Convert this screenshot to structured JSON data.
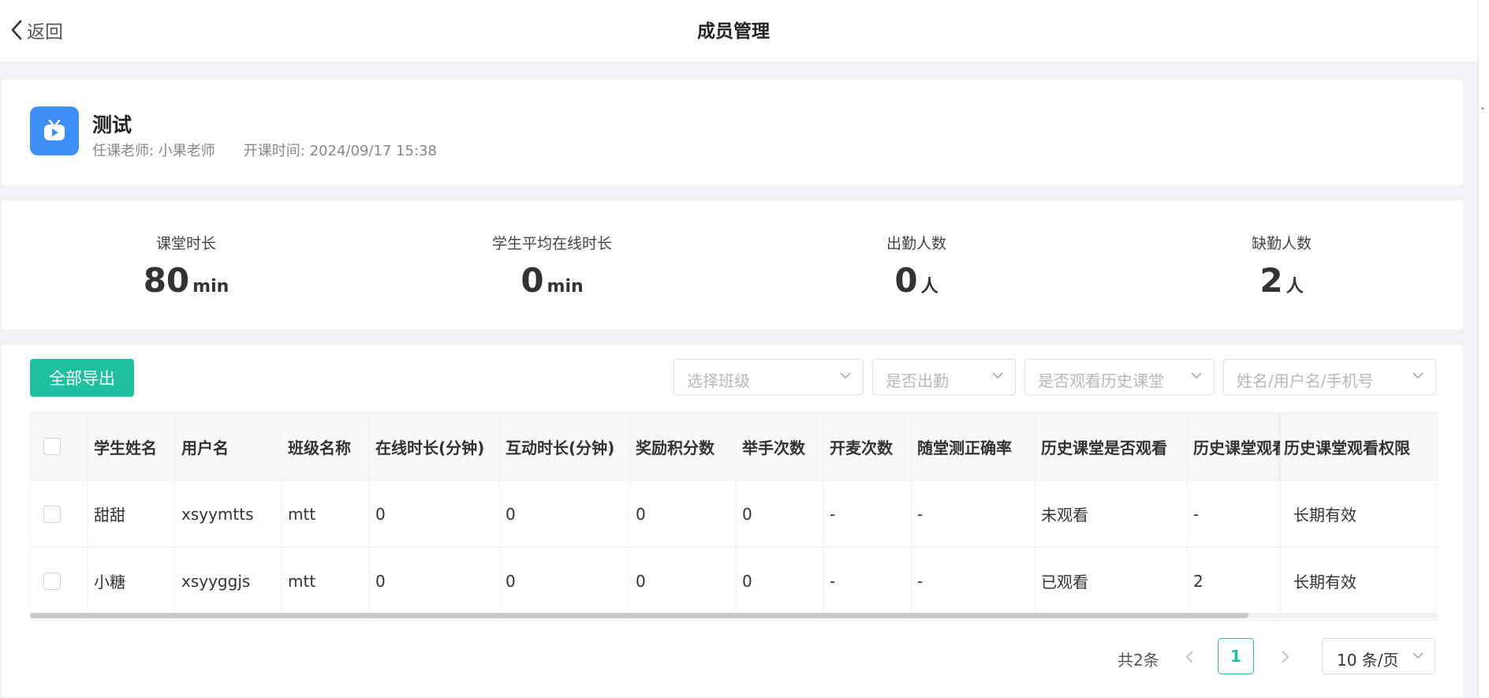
{
  "header": {
    "back_label": "返回",
    "title": "成员管理"
  },
  "course": {
    "icon": "tv-play-icon",
    "name": "测试",
    "teacher": "任课老师: 小果老师",
    "start_time": "开课时间: 2024/09/17 15:38"
  },
  "stats": [
    {
      "label": "课堂时长",
      "value": "80",
      "unit": "min"
    },
    {
      "label": "学生平均在线时长",
      "value": "0",
      "unit": "min"
    },
    {
      "label": "出勤人数",
      "value": "0",
      "unit": "人"
    },
    {
      "label": "缺勤人数",
      "value": "2",
      "unit": "人"
    }
  ],
  "toolbar": {
    "export_label": "全部导出",
    "filters": {
      "class_placeholder": "选择班级",
      "attendance_placeholder": "是否出勤",
      "history_placeholder": "是否观看历史课堂",
      "search_placeholder": "姓名/用户名/手机号"
    }
  },
  "table": {
    "columns": [
      "学生姓名",
      "用户名",
      "班级名称",
      "在线时长(分钟)",
      "互动时长(分钟)",
      "奖励积分数",
      "举手次数",
      "开麦次数",
      "随堂测正确率",
      "历史课堂是否观看",
      "历史课堂观看",
      "历史课堂观看权限"
    ],
    "rows": [
      [
        "甜甜",
        "xsyymtts",
        "mtt",
        "0",
        "0",
        "0",
        "0",
        "-",
        "-",
        "未观看",
        "-",
        "长期有效"
      ],
      [
        "小糖",
        "xsyyggjs",
        "mtt",
        "0",
        "0",
        "0",
        "0",
        "-",
        "-",
        "已观看",
        "2",
        "长期有效"
      ]
    ]
  },
  "pagination": {
    "total": "共2条",
    "current_page": "1",
    "page_size": "10 条/页"
  },
  "colors": {
    "accent": "#1ec0a0",
    "icon_bg": "#3d8ef5"
  }
}
